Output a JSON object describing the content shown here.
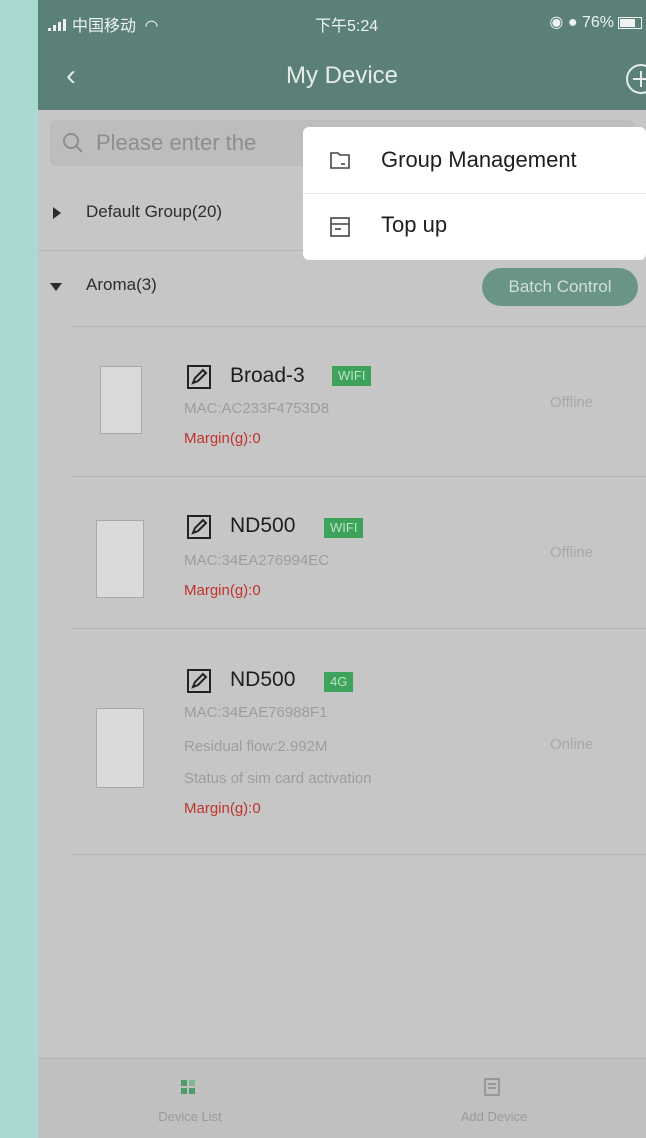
{
  "status_bar": {
    "carrier": "中国移动",
    "time": "下午5:24",
    "battery": "76%"
  },
  "nav": {
    "title": "My Device"
  },
  "search": {
    "placeholder": "Please enter the"
  },
  "groups": [
    {
      "label": "Default Group(20)",
      "expanded": false
    },
    {
      "label": "Aroma(3)",
      "expanded": true
    }
  ],
  "batch_control_label": "Batch Control",
  "devices": [
    {
      "name": "Broad-3",
      "connection": "WIFI",
      "mac": "MAC:AC233F4753D8",
      "margin": "Margin(g):0",
      "status": "Offline"
    },
    {
      "name": "ND500",
      "connection": "WIFI",
      "mac": "MAC:34EA276994EC",
      "margin": "Margin(g):0",
      "status": "Offline"
    },
    {
      "name": "ND500",
      "connection": "4G",
      "mac": "MAC:34EAE76988F1",
      "residual_flow": "Residual flow:2.992M",
      "sim_status": "Status of sim card activation",
      "margin": "Margin(g):0",
      "status": "Online"
    }
  ],
  "menu": [
    {
      "label": "Group Management",
      "icon": "folder-icon"
    },
    {
      "label": "Top up",
      "icon": "document-icon"
    }
  ],
  "tabs": [
    {
      "label": "Device List",
      "icon": "grid-icon"
    },
    {
      "label": "Add Device",
      "icon": "list-icon"
    }
  ],
  "colors": {
    "header": "#5b8077",
    "badge_green": "#3ea35a",
    "margin_red": "#c0332e",
    "batch_button": "#6a9487"
  }
}
